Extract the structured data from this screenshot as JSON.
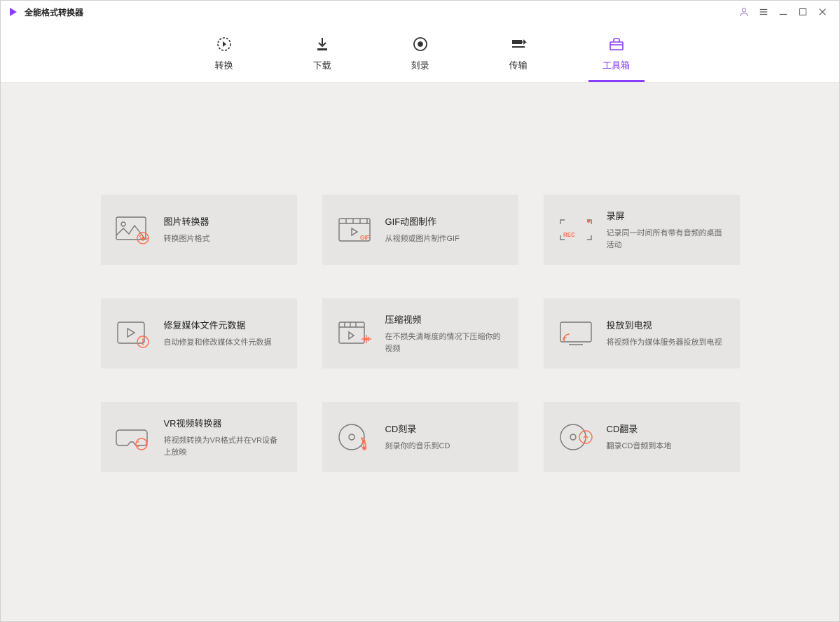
{
  "app": {
    "title": "全能格式转换器"
  },
  "tabs": [
    {
      "label": "转换"
    },
    {
      "label": "下载"
    },
    {
      "label": "刻录"
    },
    {
      "label": "传输"
    },
    {
      "label": "工具箱"
    }
  ],
  "tools": [
    {
      "title": "图片转换器",
      "desc": "转换图片格式"
    },
    {
      "title": "GIF动图制作",
      "desc": "从视频或图片制作GIF"
    },
    {
      "title": "录屏",
      "desc": "记录同一时间所有带有音频的桌面活动"
    },
    {
      "title": "修复媒体文件元数据",
      "desc": "自动修复和修改媒体文件元数据"
    },
    {
      "title": "压缩视频",
      "desc": "在不损失清晰度的情况下压缩你的视频"
    },
    {
      "title": "投放到电视",
      "desc": "将视频作为媒体服务器投放到电视"
    },
    {
      "title": "VR视频转换器",
      "desc": "将视频转换为VR格式并在VR设备上放映"
    },
    {
      "title": "CD刻录",
      "desc": "刻录你的音乐到CD"
    },
    {
      "title": "CD翻录",
      "desc": "翻录CD音频到本地"
    }
  ]
}
